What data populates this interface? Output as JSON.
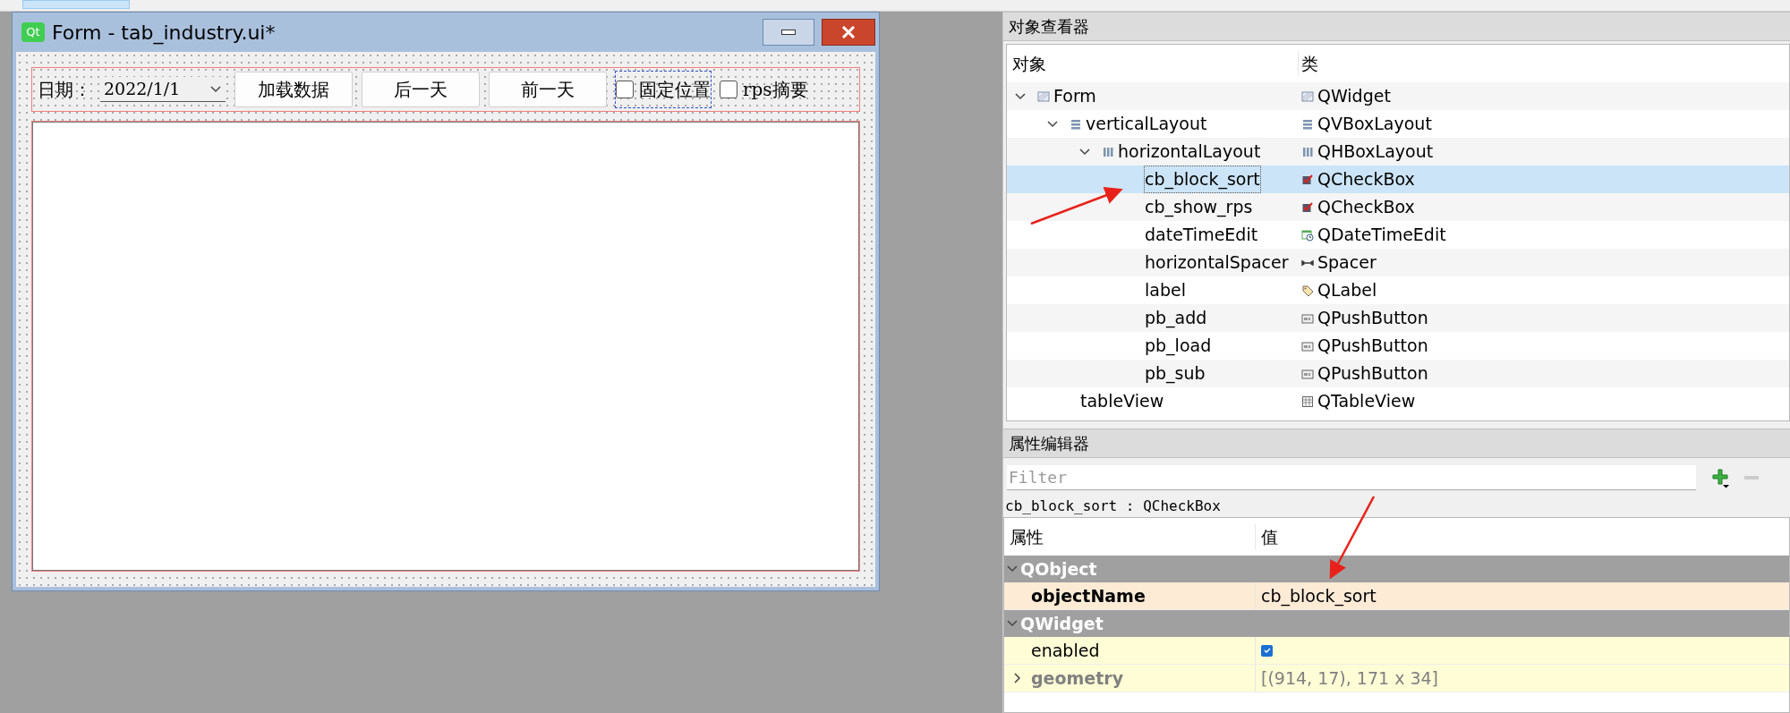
{
  "form_window": {
    "logo": "Qt",
    "title": "Form - tab_industry.ui*",
    "toolbar": {
      "date_label": "日期：",
      "date_value": "2022/1/1",
      "buttons": [
        "加载数据",
        "后一天",
        "前一天"
      ],
      "checkboxes": [
        {
          "label": "固定位置",
          "checked": false,
          "selected": true
        },
        {
          "label": "rps摘要",
          "checked": false,
          "selected": false
        }
      ]
    }
  },
  "object_inspector": {
    "title": "对象查看器",
    "columns": [
      "对象",
      "类"
    ],
    "tree": [
      {
        "name": "Form",
        "class": "QWidget",
        "kind": "widget",
        "expanded": true,
        "selected": false,
        "children": [
          {
            "name": "verticalLayout",
            "class": "QVBoxLayout",
            "kind": "vlayout",
            "expanded": true,
            "selected": false,
            "children": [
              {
                "name": "horizontalLayout",
                "class": "QHBoxLayout",
                "kind": "hlayout",
                "expanded": true,
                "selected": false,
                "children": [
                  {
                    "name": "cb_block_sort",
                    "class": "QCheckBox",
                    "kind": "checkbox",
                    "selected": true
                  },
                  {
                    "name": "cb_show_rps",
                    "class": "QCheckBox",
                    "kind": "checkbox",
                    "selected": false
                  },
                  {
                    "name": "dateTimeEdit",
                    "class": "QDateTimeEdit",
                    "kind": "datetime",
                    "selected": false
                  },
                  {
                    "name": "horizontalSpacer",
                    "class": "Spacer",
                    "kind": "spacer",
                    "selected": false
                  },
                  {
                    "name": "label",
                    "class": "QLabel",
                    "kind": "label",
                    "selected": false
                  },
                  {
                    "name": "pb_add",
                    "class": "QPushButton",
                    "kind": "button",
                    "selected": false
                  },
                  {
                    "name": "pb_load",
                    "class": "QPushButton",
                    "kind": "button",
                    "selected": false
                  },
                  {
                    "name": "pb_sub",
                    "class": "QPushButton",
                    "kind": "button",
                    "selected": false
                  }
                ]
              }
            ]
          },
          {
            "name": "tableView",
            "class": "QTableView",
            "kind": "table",
            "selected": false
          }
        ]
      }
    ]
  },
  "property_editor": {
    "title": "属性编辑器",
    "filter": {
      "placeholder": "Filter"
    },
    "current": "cb_block_sort : QCheckBox",
    "columns": [
      "属性",
      "值"
    ],
    "groups": [
      {
        "name": "QObject",
        "color": "#fdebd6",
        "properties": [
          {
            "name": "objectName",
            "kind": "text",
            "value": "cb_block_sort",
            "changed": true,
            "disabled": false
          }
        ]
      },
      {
        "name": "QWidget",
        "color": "#fffdd6",
        "properties": [
          {
            "name": "enabled",
            "kind": "checkbox",
            "checked": true,
            "changed": false,
            "disabled": false
          },
          {
            "name": "geometry",
            "kind": "text",
            "value": "[(914, 17), 171 x 34]",
            "changed": true,
            "disabled": true,
            "expanded": false
          }
        ]
      }
    ]
  }
}
